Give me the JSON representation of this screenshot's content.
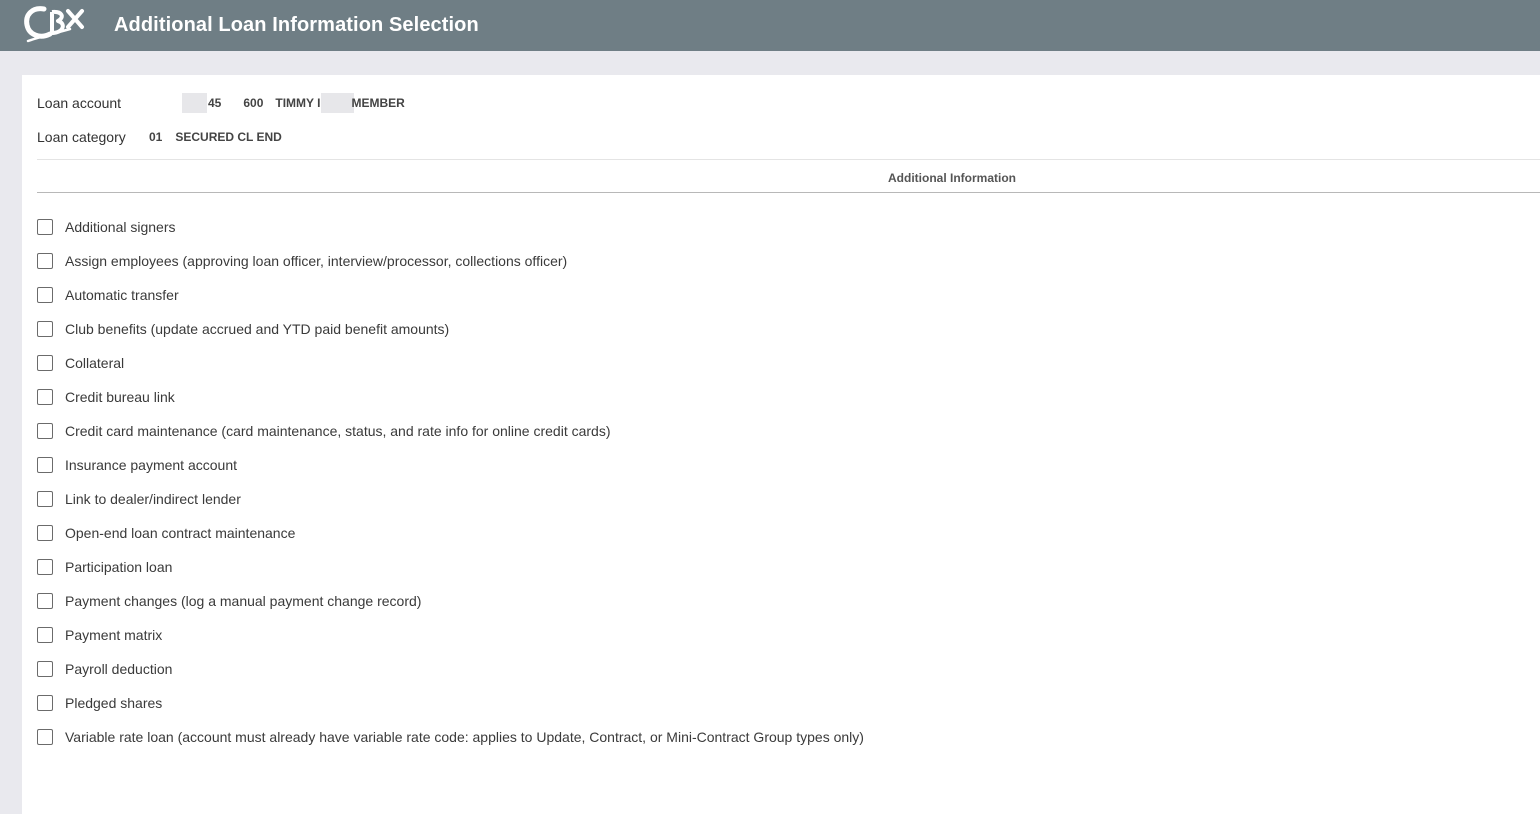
{
  "header": {
    "title": "Additional Loan Information Selection",
    "logo_text": "CBX",
    "logo_icon": "cu-logo-icon"
  },
  "loan_account": {
    "label": "Loan account",
    "account_suffix": "45",
    "loan_id": "600",
    "member_first": "TIMMY I",
    "member_last": "MEMBER"
  },
  "loan_category": {
    "label": "Loan category",
    "code": "01",
    "description": "SECURED CL END"
  },
  "section": {
    "title": "Additional Information"
  },
  "options": [
    {
      "label": "Additional signers"
    },
    {
      "label": "Assign employees (approving loan officer, interview/processor, collections officer)"
    },
    {
      "label": "Automatic transfer"
    },
    {
      "label": "Club benefits (update accrued and YTD paid benefit amounts)"
    },
    {
      "label": "Collateral"
    },
    {
      "label": "Credit bureau link"
    },
    {
      "label": "Credit card maintenance (card maintenance, status, and rate info for online credit cards)"
    },
    {
      "label": "Insurance payment account"
    },
    {
      "label": "Link to dealer/indirect lender"
    },
    {
      "label": "Open-end loan contract maintenance"
    },
    {
      "label": "Participation loan"
    },
    {
      "label": "Payment changes (log a manual payment change record)"
    },
    {
      "label": "Payment matrix"
    },
    {
      "label": "Payroll deduction"
    },
    {
      "label": "Pledged shares"
    },
    {
      "label": "Variable rate loan (account must already have variable rate code: applies to Update, Contract, or Mini-Contract Group types only)"
    }
  ],
  "colors": {
    "header_bg": "#6f7e85",
    "page_bg": "#e9e9ee",
    "panel_bg": "#ffffff"
  }
}
